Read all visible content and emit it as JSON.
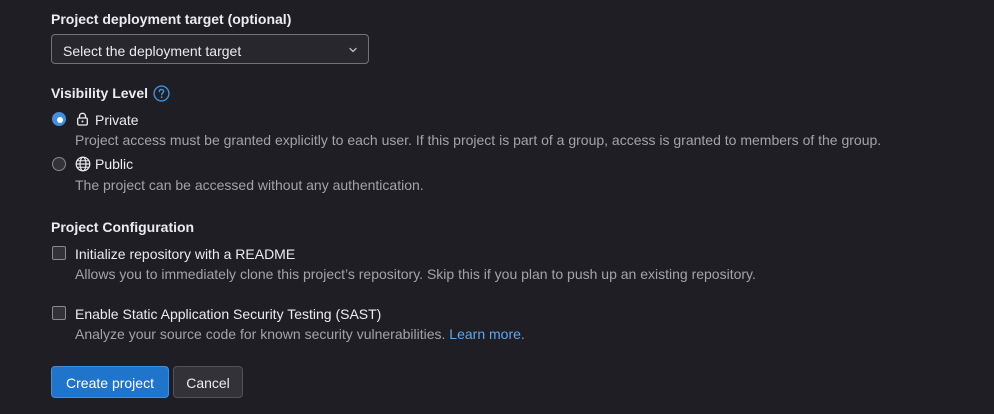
{
  "deployment": {
    "label": "Project deployment target (optional)",
    "select_value": "Select the deployment target"
  },
  "visibility": {
    "label": "Visibility Level",
    "help_icon": "question-circle-icon",
    "options": [
      {
        "label": "Private",
        "icon": "lock-icon",
        "selected": true,
        "description": "Project access must be granted explicitly to each user. If this project is part of a group, access is granted to members of the group."
      },
      {
        "label": "Public",
        "icon": "globe-icon",
        "selected": false,
        "description": "The project can be accessed without any authentication."
      }
    ]
  },
  "configuration": {
    "label": "Project Configuration",
    "items": [
      {
        "label": "Initialize repository with a README",
        "checked": false,
        "description": "Allows you to immediately clone this project’s repository. Skip this if you plan to push up an existing repository."
      },
      {
        "label": "Enable Static Application Security Testing (SAST)",
        "checked": false,
        "description": "Analyze your source code for known security vulnerabilities.",
        "link_text": "Learn more."
      }
    ]
  },
  "actions": {
    "create_label": "Create project",
    "cancel_label": "Cancel"
  },
  "colors": {
    "background": "#1f1e24",
    "primary": "#1f75cb",
    "link": "#63a6e9",
    "text": "#ececef",
    "muted": "#a4a3a8"
  }
}
